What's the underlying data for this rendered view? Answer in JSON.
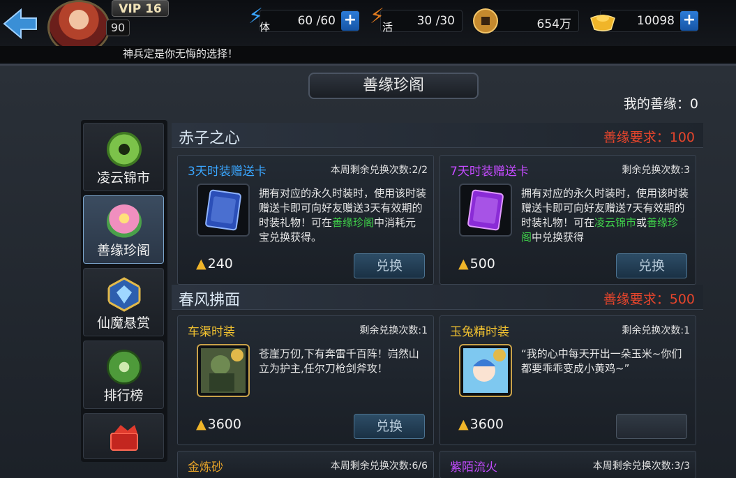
{
  "top": {
    "vip": "VIP 16",
    "level": "90",
    "stamina": {
      "label": "体",
      "value": "60 /60"
    },
    "energy": {
      "label": "活",
      "value": "30 /30"
    },
    "coins": {
      "value": "654万"
    },
    "gold": {
      "value": "10098"
    },
    "plus": "+",
    "marquee": "神兵定是你无悔的选择！"
  },
  "panel": {
    "title": "善缘珍阁",
    "my_score": "我的善缘：0"
  },
  "sidebar": [
    {
      "label": "凌云锦市",
      "icon": "jade-disc-icon"
    },
    {
      "label": "善缘珍阁",
      "icon": "lotus-icon",
      "active": true
    },
    {
      "label": "仙魔悬赏",
      "icon": "diamond-badge-icon"
    },
    {
      "label": "排行榜",
      "icon": "jade-medal-icon"
    },
    {
      "label": "",
      "icon": "red-chest-icon"
    }
  ],
  "sections": [
    {
      "name": "赤子之心",
      "requirement": "善缘要求：100",
      "cards": [
        {
          "title": "3天时装赠送卡",
          "limit": "本周剩余兑换次数:2/2",
          "desc_parts": [
            "拥有对应的永久时装时，使用该时装赠送卡即可向好友赠送3天有效期的时装礼物！可在",
            "善缘珍阁",
            "中消耗元宝兑换获得。"
          ],
          "cost": "240",
          "button": "兑换"
        },
        {
          "title": "7天时装赠送卡",
          "limit": "剩余兑换次数:3",
          "desc_parts": [
            "拥有对应的永久时装时，使用该时装赠送卡即可向好友赠送7天有效期的时装礼物！可在",
            "凌云锦市",
            "或",
            "善缘珍阁",
            "中兑换获得"
          ],
          "cost": "500",
          "button": "兑换"
        }
      ]
    },
    {
      "name": "春风拂面",
      "requirement": "善缘要求：500",
      "cards": [
        {
          "title": "车渠时装",
          "limit": "剩余兑换次数:1",
          "desc": "苍崖万仞,下有奔雷千百阵！岿然山立为护主,任尔刀枪剑斧攻！",
          "cost": "3600",
          "button": "兑换"
        },
        {
          "title": "玉兔精时装",
          "limit": "剩余兑换次数:1",
          "desc": "“我的心中每天开出一朵玉米~你们都要乖乖变成小黄鸡~”",
          "cost": "3600",
          "button": ""
        }
      ]
    },
    {
      "cards": [
        {
          "title": "金炼砂",
          "limit": "本周剩余兑换次数:6/6"
        },
        {
          "title": "紫陌流火",
          "limit": "本周剩余兑换次数:3/3"
        }
      ]
    }
  ],
  "colors": {
    "requirement": "#e6452c",
    "highlight": "#3fd14a",
    "title_blue": "#3aa6ff",
    "title_purple": "#c44bff",
    "title_yellow": "#f2c230"
  }
}
